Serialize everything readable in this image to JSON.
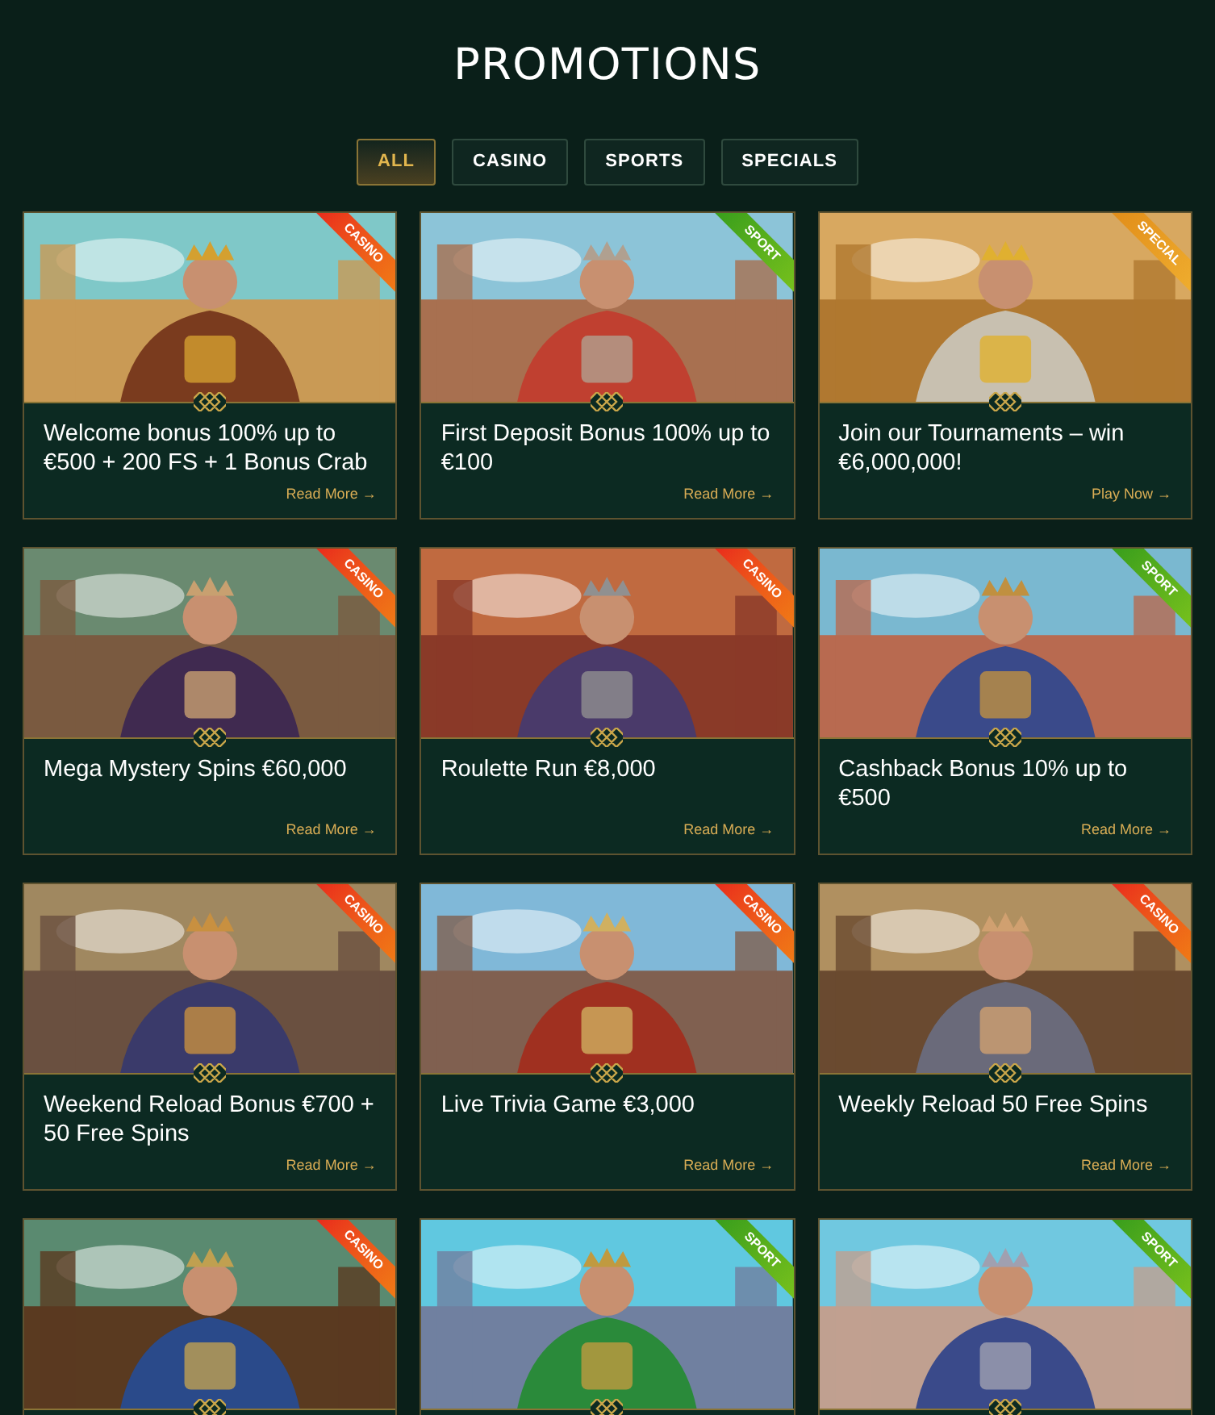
{
  "page_title": "PROMOTIONS",
  "tabs": [
    {
      "label": "ALL",
      "selected": true
    },
    {
      "label": "CASINO",
      "selected": false
    },
    {
      "label": "SPORTS",
      "selected": false
    },
    {
      "label": "SPECIALS",
      "selected": false
    }
  ],
  "promotions": [
    {
      "kind": "casino",
      "ribbon": "CASINO",
      "title": "Welcome bonus 100% up to €500 + 200 FS + 1 Bonus Crab",
      "link": "Read More →"
    },
    {
      "kind": "sport",
      "ribbon": "SPORT",
      "title": "First Deposit Bonus 100% up to €100",
      "link": "Read More →"
    },
    {
      "kind": "special",
      "ribbon": "SPECIAL",
      "title": "Join our Tournaments – win €6,000,000!",
      "link": "Play Now →"
    },
    {
      "kind": "casino",
      "ribbon": "CASINO",
      "title": "Mega Mystery Spins €60,000",
      "link": "Read More →"
    },
    {
      "kind": "casino",
      "ribbon": "CASINO",
      "title": "Roulette Run €8,000",
      "link": "Read More →"
    },
    {
      "kind": "sport",
      "ribbon": "SPORT",
      "title": "Cashback Bonus 10% up to €500",
      "link": "Read More →"
    },
    {
      "kind": "casino",
      "ribbon": "CASINO",
      "title": "Weekend Reload Bonus €700 + 50 Free Spins",
      "link": "Read More →"
    },
    {
      "kind": "casino",
      "ribbon": "CASINO",
      "title": "Live Trivia Game €3,000",
      "link": "Read More →"
    },
    {
      "kind": "casino",
      "ribbon": "CASINO",
      "title": "Weekly Reload 50 Free Spins",
      "link": "Read More →"
    },
    {
      "kind": "casino",
      "ribbon": "CASINO"
    },
    {
      "kind": "sport",
      "ribbon": "SPORT"
    },
    {
      "kind": "sport",
      "ribbon": "SPORT"
    }
  ]
}
